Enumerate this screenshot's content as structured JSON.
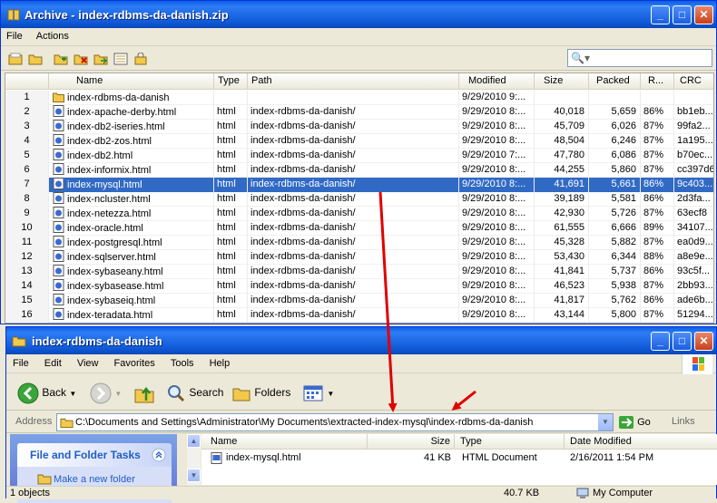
{
  "archive": {
    "title": "Archive - index-rdbms-da-danish.zip",
    "menu": [
      "File",
      "Actions"
    ],
    "search_placeholder": "",
    "columns": [
      "Name",
      "Type",
      "Path",
      "Modified",
      "Size",
      "Packed",
      "R...",
      "CRC"
    ],
    "rows": [
      {
        "n": "1",
        "name": "index-rdbms-da-danish",
        "type": "",
        "path": "",
        "modified": "9/29/2010 9:...",
        "size": "",
        "packed": "",
        "ratio": "",
        "crc": "",
        "folder": true
      },
      {
        "n": "2",
        "name": "index-apache-derby.html",
        "type": "html",
        "path": "index-rdbms-da-danish/",
        "modified": "9/29/2010 8:...",
        "size": "40,018",
        "packed": "5,659",
        "ratio": "86%",
        "crc": "bb1eb..."
      },
      {
        "n": "3",
        "name": "index-db2-iseries.html",
        "type": "html",
        "path": "index-rdbms-da-danish/",
        "modified": "9/29/2010 8:...",
        "size": "45,709",
        "packed": "6,026",
        "ratio": "87%",
        "crc": "99fa2..."
      },
      {
        "n": "4",
        "name": "index-db2-zos.html",
        "type": "html",
        "path": "index-rdbms-da-danish/",
        "modified": "9/29/2010 8:...",
        "size": "48,504",
        "packed": "6,246",
        "ratio": "87%",
        "crc": "1a195..."
      },
      {
        "n": "5",
        "name": "index-db2.html",
        "type": "html",
        "path": "index-rdbms-da-danish/",
        "modified": "9/29/2010 7:...",
        "size": "47,780",
        "packed": "6,086",
        "ratio": "87%",
        "crc": "b70ec..."
      },
      {
        "n": "6",
        "name": "index-informix.html",
        "type": "html",
        "path": "index-rdbms-da-danish/",
        "modified": "9/29/2010 8:...",
        "size": "44,255",
        "packed": "5,860",
        "ratio": "87%",
        "crc": "cc397d6"
      },
      {
        "n": "7",
        "name": "index-mysql.html",
        "type": "html",
        "path": "index-rdbms-da-danish/",
        "modified": "9/29/2010 8:...",
        "size": "41,691",
        "packed": "5,661",
        "ratio": "86%",
        "crc": "9c403...",
        "selected": true
      },
      {
        "n": "8",
        "name": "index-ncluster.html",
        "type": "html",
        "path": "index-rdbms-da-danish/",
        "modified": "9/29/2010 8:...",
        "size": "39,189",
        "packed": "5,581",
        "ratio": "86%",
        "crc": "2d3fa..."
      },
      {
        "n": "9",
        "name": "index-netezza.html",
        "type": "html",
        "path": "index-rdbms-da-danish/",
        "modified": "9/29/2010 8:...",
        "size": "42,930",
        "packed": "5,726",
        "ratio": "87%",
        "crc": "63ecf8"
      },
      {
        "n": "10",
        "name": "index-oracle.html",
        "type": "html",
        "path": "index-rdbms-da-danish/",
        "modified": "9/29/2010 8:...",
        "size": "61,555",
        "packed": "6,666",
        "ratio": "89%",
        "crc": "34107..."
      },
      {
        "n": "11",
        "name": "index-postgresql.html",
        "type": "html",
        "path": "index-rdbms-da-danish/",
        "modified": "9/29/2010 8:...",
        "size": "45,328",
        "packed": "5,882",
        "ratio": "87%",
        "crc": "ea0d9..."
      },
      {
        "n": "12",
        "name": "index-sqlserver.html",
        "type": "html",
        "path": "index-rdbms-da-danish/",
        "modified": "9/29/2010 8:...",
        "size": "53,430",
        "packed": "6,344",
        "ratio": "88%",
        "crc": "a8e9e..."
      },
      {
        "n": "13",
        "name": "index-sybaseany.html",
        "type": "html",
        "path": "index-rdbms-da-danish/",
        "modified": "9/29/2010 8:...",
        "size": "41,841",
        "packed": "5,737",
        "ratio": "86%",
        "crc": "93c5f..."
      },
      {
        "n": "14",
        "name": "index-sybasease.html",
        "type": "html",
        "path": "index-rdbms-da-danish/",
        "modified": "9/29/2010 8:...",
        "size": "46,523",
        "packed": "5,938",
        "ratio": "87%",
        "crc": "2bb93..."
      },
      {
        "n": "15",
        "name": "index-sybaseiq.html",
        "type": "html",
        "path": "index-rdbms-da-danish/",
        "modified": "9/29/2010 8:...",
        "size": "41,817",
        "packed": "5,762",
        "ratio": "86%",
        "crc": "ade6b..."
      },
      {
        "n": "16",
        "name": "index-teradata.html",
        "type": "html",
        "path": "index-rdbms-da-danish/",
        "modified": "9/29/2010 8:...",
        "size": "43,144",
        "packed": "5,800",
        "ratio": "87%",
        "crc": "51294..."
      }
    ]
  },
  "explorer": {
    "title": "index-rdbms-da-danish",
    "menu": [
      "File",
      "Edit",
      "View",
      "Favorites",
      "Tools",
      "Help"
    ],
    "toolbar": {
      "back": "Back",
      "search": "Search",
      "folders": "Folders"
    },
    "address_label": "Address",
    "address_value": "C:\\Documents and Settings\\Administrator\\My Documents\\extracted-index-mysql\\index-rdbms-da-danish",
    "go": "Go",
    "links": "Links",
    "task_header": "File and Folder Tasks",
    "task_item": "Make a new folder",
    "columns": [
      "Name",
      "Size",
      "Type",
      "Date Modified"
    ],
    "file": {
      "name": "index-mysql.html",
      "size": "41 KB",
      "type": "HTML Document",
      "date": "2/16/2011 1:54 PM"
    },
    "status": {
      "objects": "1 objects",
      "size": "40.7 KB",
      "location": "My Computer"
    }
  },
  "colors": {
    "selection": "#316ac5",
    "title_blue": "#0a5fe8",
    "arrow": "#e00000"
  }
}
